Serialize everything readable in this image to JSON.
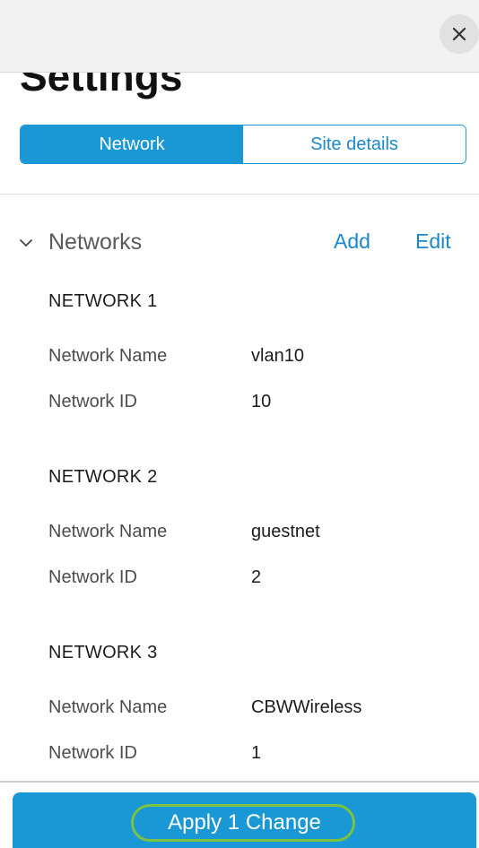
{
  "header": {
    "title": "Settings",
    "close_icon": "close-icon"
  },
  "tabs": [
    {
      "label": "Network",
      "active": true
    },
    {
      "label": "Site details",
      "active": false
    }
  ],
  "section": {
    "title": "Networks",
    "add_label": "Add",
    "edit_label": "Edit",
    "toggle_icon": "chevron-down-icon"
  },
  "networks": [
    {
      "heading": "NETWORK 1",
      "name_label": "Network Name",
      "name_value": "vlan10",
      "id_label": "Network ID",
      "id_value": "10"
    },
    {
      "heading": "NETWORK 2",
      "name_label": "Network Name",
      "name_value": "guestnet",
      "id_label": "Network ID",
      "id_value": "2"
    },
    {
      "heading": "NETWORK 3",
      "name_label": "Network Name",
      "name_value": "CBWWireless",
      "id_label": "Network ID",
      "id_value": "1"
    }
  ],
  "footer": {
    "apply_label": "Apply 1 Change"
  },
  "colors": {
    "accent": "#1a98d5",
    "link": "#1a88c9",
    "highlight": "#7cc242"
  }
}
